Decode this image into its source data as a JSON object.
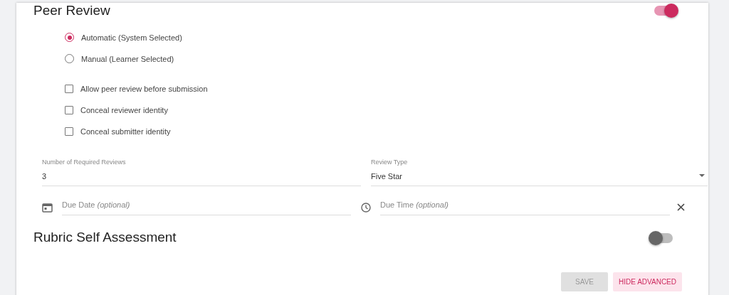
{
  "peer_review": {
    "title": "Peer Review",
    "on": true,
    "mode_options": [
      {
        "label": "Automatic (System Selected)",
        "selected": true
      },
      {
        "label": "Manual (Learner Selected)",
        "selected": false
      }
    ],
    "options": [
      {
        "label": "Allow peer review before submission",
        "checked": false
      },
      {
        "label": "Conceal reviewer identity",
        "checked": false
      },
      {
        "label": "Conceal submitter identity",
        "checked": false
      }
    ],
    "required_reviews": {
      "label": "Number of Required Reviews",
      "value": "3"
    },
    "review_type": {
      "label": "Review Type",
      "value": "Five Star"
    },
    "due_date": {
      "placeholder": "Due Date *(optional)*"
    },
    "due_time": {
      "placeholder": "Due Time *(optional)*"
    }
  },
  "rubric_self_assessment": {
    "title": "Rubric Self Assessment",
    "on": false
  },
  "buttons": [
    {
      "label": "SAVE",
      "kind": "save",
      "disabled": true
    },
    {
      "label": "HIDE ADVANCED",
      "kind": "secondary"
    }
  ]
}
